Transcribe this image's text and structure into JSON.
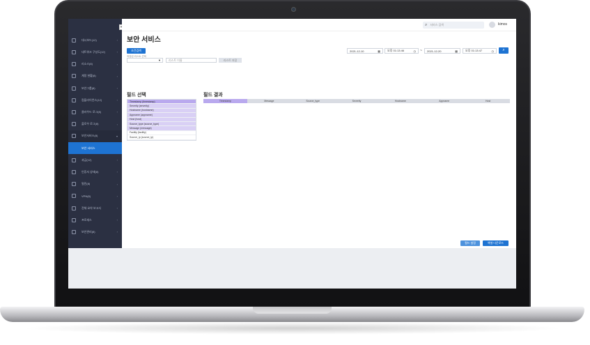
{
  "app": {
    "page_title": "보안 서비스",
    "search_placeholder": "서비스 검색",
    "username": "kimos"
  },
  "sidebar": {
    "items": [
      {
        "label": "대시보드(12)",
        "icon": "grid-icon"
      },
      {
        "label": "네트워크 구성도(12)",
        "icon": "network-icon"
      },
      {
        "label": "리소스(8)",
        "icon": "tree-icon"
      },
      {
        "label": "계정 현황(8)",
        "icon": "user-icon"
      },
      {
        "label": "보안그룹(8)",
        "icon": "puzzle-icon"
      },
      {
        "label": "컴플라이언스(12)",
        "icon": "compliance-icon"
      },
      {
        "label": "클라우드 로그(8)",
        "icon": "shield-icon"
      },
      {
        "label": "플로우 로그(8)",
        "icon": "flow-icon"
      },
      {
        "label": "보안서비스(8)",
        "icon": "shield-heart-icon"
      },
      {
        "label": "보안 서비스",
        "icon": ""
      },
      {
        "label": "과금(12)",
        "icon": "billing-icon"
      },
      {
        "label": "인증서 상태(8)",
        "icon": "certificate-icon"
      },
      {
        "label": "멀린(8)",
        "icon": "globe-icon"
      },
      {
        "label": "VPN(8)",
        "icon": "vpn-icon"
      },
      {
        "label": "전체 요약 보고서",
        "icon": "report-icon"
      },
      {
        "label": "프로세스",
        "icon": "process-icon"
      },
      {
        "label": "보안관리(8)",
        "icon": "gear-icon"
      }
    ],
    "active_label": "보안 서비스"
  },
  "filters": {
    "condition_button": "조건검색",
    "saved_query_hint": "저장된 리스트 선택",
    "query_name_placeholder": "리스트 이름",
    "save_list_button": "리스트 저장",
    "start_date": "2021-12-10",
    "start_time": "오후 01:13:46",
    "range_sep": "~",
    "end_date": "2021-12-20",
    "end_time": "오후 01:13:47"
  },
  "field_select": {
    "title": "필드 선택",
    "fields": [
      {
        "label": "Timestamp (timestamp)",
        "selected": true
      },
      {
        "label": "Severity (severity)",
        "selected": true
      },
      {
        "label": "Hostname (hostname)",
        "selected": true
      },
      {
        "label": "Appname (appname)",
        "selected": true
      },
      {
        "label": "Host (host)",
        "selected": true
      },
      {
        "label": "Source_type (source_type)",
        "selected": true
      },
      {
        "label": "Message (message)",
        "selected": true
      },
      {
        "label": "Facility (facility)",
        "selected": false
      },
      {
        "label": "Source_ip (source_ip)",
        "selected": false
      }
    ]
  },
  "field_result": {
    "title": "필드 결과",
    "columns": [
      "Timestamp",
      "Message",
      "Source_type",
      "Severity",
      "Hostname",
      "Appname",
      "Host"
    ]
  },
  "actions": {
    "settings_button": "필드 설정",
    "excel_button": "엑셀 다운로드"
  }
}
